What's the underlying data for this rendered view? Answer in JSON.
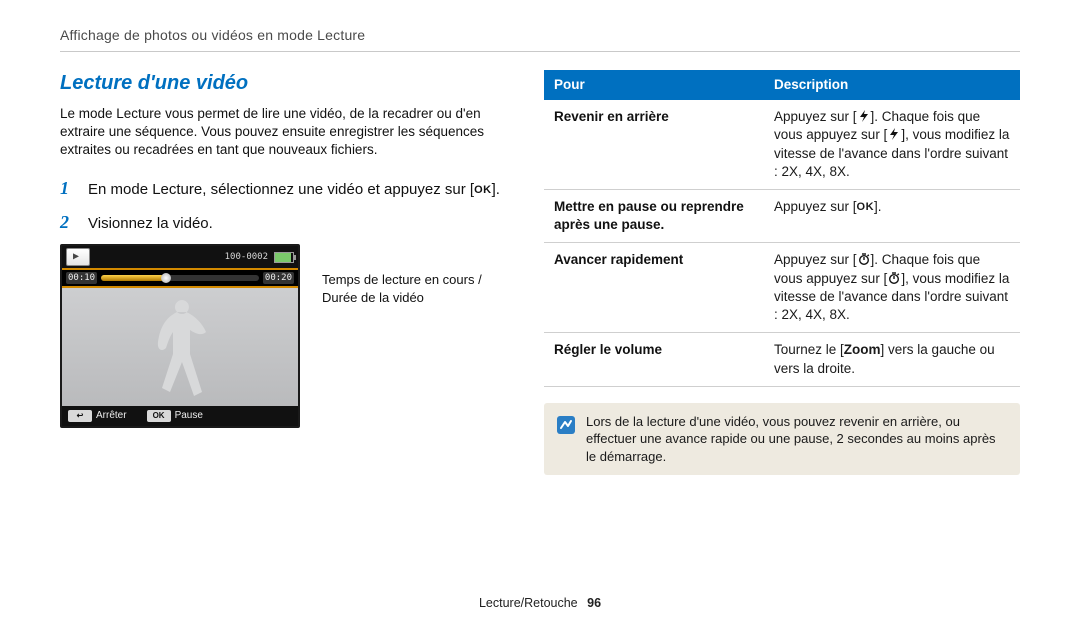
{
  "breadcrumb": "Affichage de photos ou vidéos en mode Lecture",
  "title": "Lecture d'une vidéo",
  "intro": "Le mode Lecture vous permet de lire une vidéo, de la recadrer ou d'en extraire une séquence. Vous pouvez ensuite enregistrer les séquences extraites ou recadrées en tant que nouveaux fichiers.",
  "steps": [
    {
      "num": "1",
      "text_before": "En mode Lecture, sélectionnez une vidéo et appuyez sur [",
      "ok": "OK",
      "text_after": "]."
    },
    {
      "num": "2",
      "text_before": "Visionnez la vidéo.",
      "ok": "",
      "text_after": ""
    }
  ],
  "screenshot": {
    "file_index": "100-0002",
    "time_elapsed": "00:10",
    "time_total": "00:20",
    "bottom_left_key": "↩",
    "bottom_left_label": "Arrêter",
    "bottom_right_key": "OK",
    "bottom_right_label": "Pause"
  },
  "callout": "Temps de lecture en cours / Durée de la vidéo",
  "table": {
    "h1": "Pour",
    "h2": "Description",
    "rows": [
      {
        "label": "Revenir en arrière",
        "desc_pre": "Appuyez sur [",
        "icon": "flash",
        "desc_mid": "]. Chaque fois que vous appuyez sur [",
        "icon2": "flash",
        "desc_post": "], vous modifiez la vitesse de l'avance dans l'ordre suivant : 2X, 4X, 8X."
      },
      {
        "label": "Mettre en pause ou reprendre après une pause.",
        "desc_pre": "Appuyez sur [",
        "icon": "ok",
        "desc_mid": "].",
        "icon2": "",
        "desc_post": ""
      },
      {
        "label": "Avancer rapidement",
        "desc_pre": "Appuyez sur [",
        "icon": "timer",
        "desc_mid": "]. Chaque fois que vous appuyez sur [",
        "icon2": "timer",
        "desc_post": "], vous modifiez la vitesse de l'avance dans l'ordre suivant : 2X, 4X, 8X."
      },
      {
        "label": "Régler le volume",
        "desc_pre": "Tournez le [",
        "icon": "zoom_bold",
        "desc_mid": "] vers la gauche ou vers la droite.",
        "icon2": "",
        "desc_post": ""
      }
    ]
  },
  "note": "Lors de la lecture d'une vidéo, vous pouvez revenir en arrière, ou effectuer une avance rapide ou une pause, 2 secondes au moins après le démarrage.",
  "footer_section": "Lecture/Retouche",
  "footer_page": "96"
}
